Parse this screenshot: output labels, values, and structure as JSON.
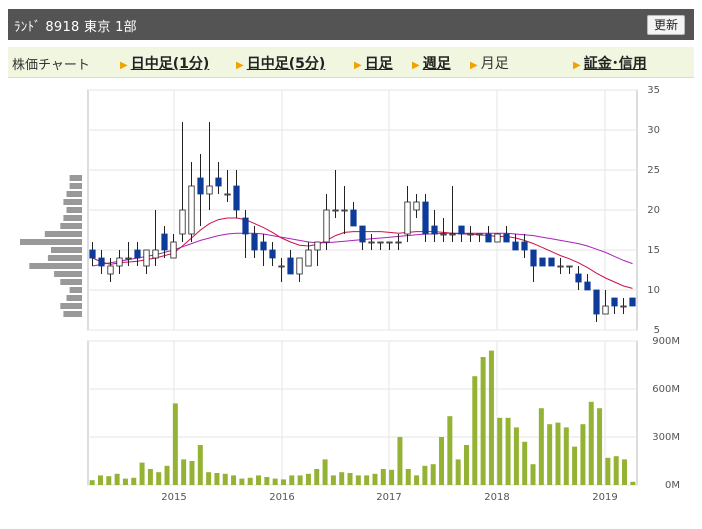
{
  "header": {
    "title": "ﾗﾝﾄﾞ  8918  東京 1部",
    "refresh_label": "更新"
  },
  "tabs": {
    "chart_label": "株価チャート",
    "items": [
      {
        "label": "日中足(1分)",
        "active": false
      },
      {
        "label": "日中足(5分)",
        "active": false
      },
      {
        "label": "日足",
        "active": false
      },
      {
        "label": "週足",
        "active": false
      },
      {
        "label": "月足",
        "active": true
      }
    ],
    "margin_label": "証金･信用"
  },
  "colors": {
    "up_candle": "#ffffff",
    "down_candle": "#0e3a99",
    "ma_short": "#cc1144",
    "ma_long": "#aa22bb",
    "volume": "#94b233",
    "volume_profile": "#999999"
  },
  "chart_data": [
    {
      "type": "candlestick",
      "period": "monthly",
      "x_ticks": [
        "2015",
        "2016",
        "2017",
        "2018",
        "2019"
      ],
      "y_ticks": [
        "5",
        "10",
        "15",
        "20",
        "25",
        "30",
        "35"
      ],
      "ylim": [
        5,
        35
      ],
      "candles": [
        {
          "o": 15,
          "h": 16,
          "l": 13,
          "c": 14
        },
        {
          "o": 14,
          "h": 15,
          "l": 12,
          "c": 13
        },
        {
          "o": 12,
          "h": 14,
          "l": 11,
          "c": 13
        },
        {
          "o": 13,
          "h": 15,
          "l": 12,
          "c": 14
        },
        {
          "o": 14,
          "h": 16,
          "l": 13,
          "c": 14
        },
        {
          "o": 15,
          "h": 16,
          "l": 13,
          "c": 14
        },
        {
          "o": 13,
          "h": 15,
          "l": 12,
          "c": 15
        },
        {
          "o": 14,
          "h": 20,
          "l": 13,
          "c": 15
        },
        {
          "o": 17,
          "h": 18,
          "l": 14,
          "c": 15
        },
        {
          "o": 14,
          "h": 17,
          "l": 14,
          "c": 16
        },
        {
          "o": 17,
          "h": 31,
          "l": 16,
          "c": 20
        },
        {
          "o": 17,
          "h": 26,
          "l": 16,
          "c": 23
        },
        {
          "o": 24,
          "h": 27,
          "l": 18,
          "c": 22
        },
        {
          "o": 22,
          "h": 31,
          "l": 20,
          "c": 23
        },
        {
          "o": 24,
          "h": 26,
          "l": 22,
          "c": 23
        },
        {
          "o": 22,
          "h": 25,
          "l": 21,
          "c": 22
        },
        {
          "o": 23,
          "h": 25,
          "l": 19,
          "c": 20
        },
        {
          "o": 19,
          "h": 20,
          "l": 14,
          "c": 17
        },
        {
          "o": 17,
          "h": 18,
          "l": 14,
          "c": 15
        },
        {
          "o": 16,
          "h": 17,
          "l": 13,
          "c": 15
        },
        {
          "o": 15,
          "h": 16,
          "l": 13,
          "c": 14
        },
        {
          "o": 13,
          "h": 14,
          "l": 11,
          "c": 13
        },
        {
          "o": 14,
          "h": 15,
          "l": 12,
          "c": 12
        },
        {
          "o": 12,
          "h": 14,
          "l": 11,
          "c": 14
        },
        {
          "o": 13,
          "h": 16,
          "l": 13,
          "c": 15
        },
        {
          "o": 15,
          "h": 16,
          "l": 13,
          "c": 16
        },
        {
          "o": 16,
          "h": 22,
          "l": 15,
          "c": 20
        },
        {
          "o": 20,
          "h": 25,
          "l": 19,
          "c": 20
        },
        {
          "o": 20,
          "h": 23,
          "l": 17,
          "c": 20
        },
        {
          "o": 20,
          "h": 21,
          "l": 18,
          "c": 18
        },
        {
          "o": 18,
          "h": 18,
          "l": 15,
          "c": 16
        },
        {
          "o": 16,
          "h": 17,
          "l": 15,
          "c": 16
        },
        {
          "o": 16,
          "h": 16,
          "l": 15,
          "c": 16
        },
        {
          "o": 16,
          "h": 16,
          "l": 15,
          "c": 16
        },
        {
          "o": 16,
          "h": 17,
          "l": 15,
          "c": 16
        },
        {
          "o": 17,
          "h": 23,
          "l": 16,
          "c": 21
        },
        {
          "o": 20,
          "h": 22,
          "l": 19,
          "c": 21
        },
        {
          "o": 21,
          "h": 22,
          "l": 16,
          "c": 17
        },
        {
          "o": 18,
          "h": 20,
          "l": 16,
          "c": 17
        },
        {
          "o": 17,
          "h": 19,
          "l": 16,
          "c": 17
        },
        {
          "o": 17,
          "h": 23,
          "l": 16,
          "c": 17
        },
        {
          "o": 18,
          "h": 18,
          "l": 16,
          "c": 17
        },
        {
          "o": 17,
          "h": 18,
          "l": 16,
          "c": 17
        },
        {
          "o": 17,
          "h": 17,
          "l": 16,
          "c": 17
        },
        {
          "o": 17,
          "h": 18,
          "l": 16,
          "c": 16
        },
        {
          "o": 16,
          "h": 17,
          "l": 16,
          "c": 17
        },
        {
          "o": 17,
          "h": 18,
          "l": 16,
          "c": 16
        },
        {
          "o": 16,
          "h": 17,
          "l": 15,
          "c": 15
        },
        {
          "o": 16,
          "h": 17,
          "l": 14,
          "c": 15
        },
        {
          "o": 15,
          "h": 15,
          "l": 11,
          "c": 13
        },
        {
          "o": 14,
          "h": 14,
          "l": 13,
          "c": 13
        },
        {
          "o": 14,
          "h": 14,
          "l": 13,
          "c": 13
        },
        {
          "o": 13,
          "h": 14,
          "l": 12,
          "c": 13
        },
        {
          "o": 13,
          "h": 13,
          "l": 12,
          "c": 13
        },
        {
          "o": 12,
          "h": 13,
          "l": 10,
          "c": 11
        },
        {
          "o": 11,
          "h": 12,
          "l": 10,
          "c": 10
        },
        {
          "o": 10,
          "h": 10,
          "l": 6,
          "c": 7
        },
        {
          "o": 7,
          "h": 10,
          "l": 7,
          "c": 8
        },
        {
          "o": 9,
          "h": 9,
          "l": 7,
          "c": 8
        },
        {
          "o": 8,
          "h": 9,
          "l": 7,
          "c": 8
        },
        {
          "o": 9,
          "h": 9,
          "l": 8,
          "c": 8
        }
      ],
      "ma_short": [
        14,
        13.5,
        13.2,
        13.4,
        13.5,
        13.6,
        13.8,
        14,
        14.3,
        14.6,
        15.5,
        16.5,
        17.5,
        18.3,
        18.8,
        19,
        19,
        18.8,
        18.3,
        17.8,
        17.2,
        16.5,
        16,
        15.6,
        15.5,
        15.7,
        16.2,
        16.8,
        17.2,
        17.3,
        17.3,
        17.3,
        17.3,
        17.2,
        17.1,
        17.2,
        17.3,
        17.3,
        17.3,
        17.2,
        17.1,
        17,
        17,
        16.9,
        16.8,
        16.7,
        16.7,
        16.5,
        16.2,
        15.8,
        15.3,
        14.8,
        14.3,
        13.9,
        13.4,
        12.8,
        12.1,
        11.5,
        11,
        10.5,
        10.2
      ],
      "ma_long": [
        13,
        13.2,
        13.4,
        13.6,
        13.8,
        14,
        14.2,
        14.4,
        14.7,
        15,
        15.4,
        15.8,
        16.2,
        16.5,
        16.8,
        17,
        17.1,
        17.1,
        17.1,
        17,
        16.8,
        16.6,
        16.4,
        16.2,
        16,
        15.9,
        15.9,
        16,
        16.1,
        16.2,
        16.3,
        16.4,
        16.5,
        16.6,
        16.7,
        16.8,
        16.9,
        17,
        17,
        17.1,
        17.1,
        17.1,
        17.1,
        17.1,
        17.1,
        17.1,
        17.1,
        17,
        16.9,
        16.8,
        16.6,
        16.4,
        16.2,
        16,
        15.8,
        15.5,
        15.1,
        14.7,
        14.2,
        13.7,
        13.3
      ],
      "volume_profile": [
        {
          "price": 7,
          "size": 0.3
        },
        {
          "price": 8,
          "size": 0.35
        },
        {
          "price": 9,
          "size": 0.25
        },
        {
          "price": 10,
          "size": 0.2
        },
        {
          "price": 11,
          "size": 0.35
        },
        {
          "price": 12,
          "size": 0.45
        },
        {
          "price": 13,
          "size": 0.85
        },
        {
          "price": 14,
          "size": 0.55
        },
        {
          "price": 15,
          "size": 0.5
        },
        {
          "price": 16,
          "size": 1.0
        },
        {
          "price": 17,
          "size": 0.6
        },
        {
          "price": 18,
          "size": 0.35
        },
        {
          "price": 19,
          "size": 0.3
        },
        {
          "price": 20,
          "size": 0.25
        },
        {
          "price": 21,
          "size": 0.3
        },
        {
          "price": 22,
          "size": 0.25
        },
        {
          "price": 23,
          "size": 0.2
        },
        {
          "price": 24,
          "size": 0.2
        }
      ]
    },
    {
      "type": "bar",
      "series_label": "volume",
      "x_ticks": [
        "2015",
        "2016",
        "2017",
        "2018",
        "2019"
      ],
      "y_ticks": [
        "0M",
        "300M",
        "600M",
        "900M"
      ],
      "ylim": [
        0,
        900
      ],
      "values": [
        30,
        60,
        55,
        70,
        40,
        45,
        140,
        100,
        80,
        120,
        510,
        160,
        150,
        250,
        80,
        75,
        70,
        60,
        40,
        45,
        60,
        50,
        40,
        35,
        60,
        60,
        70,
        100,
        160,
        60,
        80,
        75,
        60,
        60,
        70,
        100,
        95,
        300,
        100,
        60,
        120,
        130,
        300,
        430,
        160,
        250,
        680,
        800,
        840,
        420,
        420,
        360,
        270,
        130,
        480,
        380,
        390,
        360,
        240,
        380,
        520,
        480,
        170,
        180,
        160,
        20
      ]
    }
  ]
}
